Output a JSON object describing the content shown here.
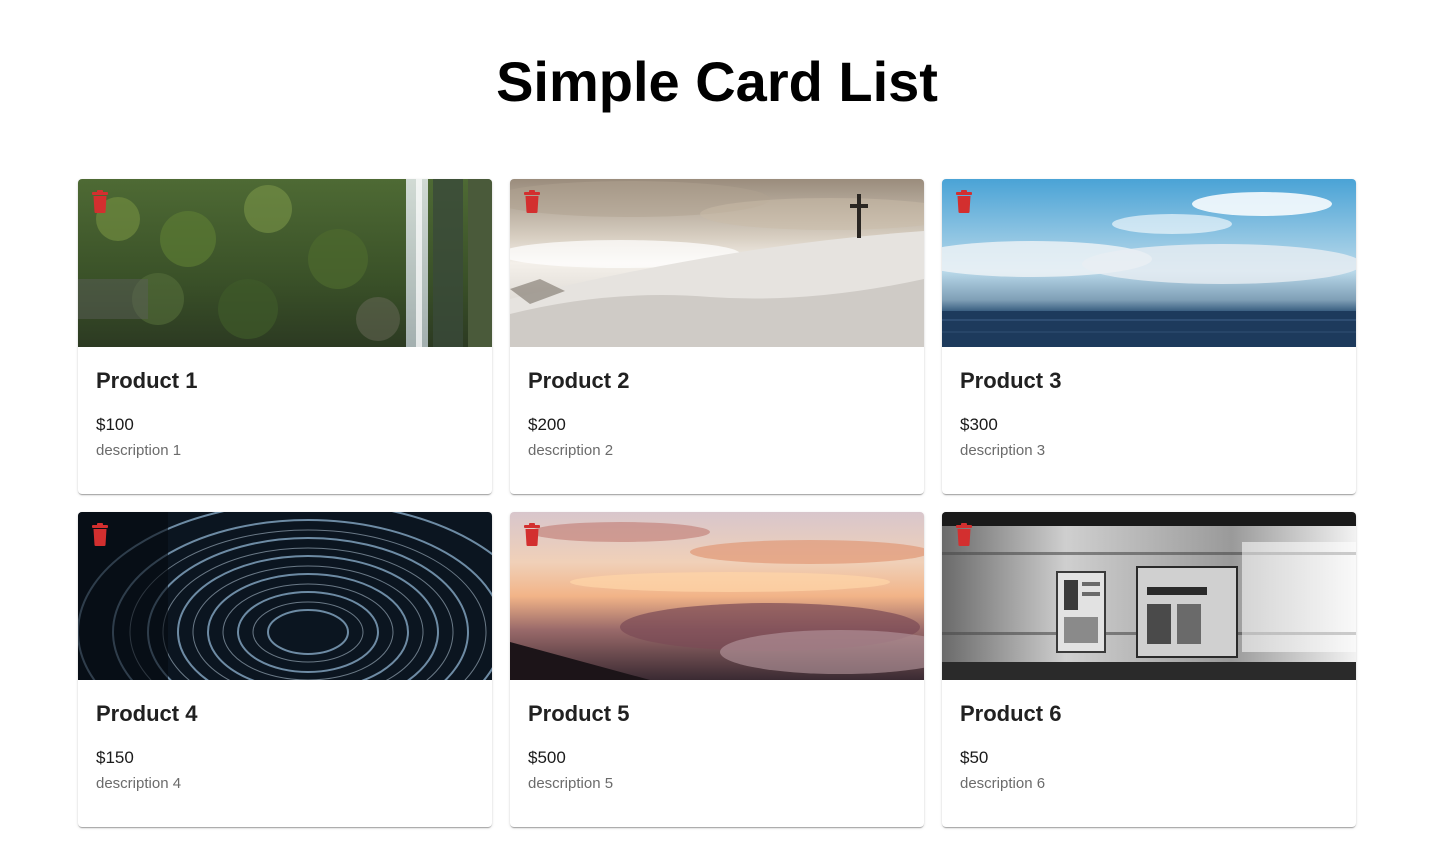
{
  "page": {
    "title": "Simple Card List"
  },
  "accent": {
    "delete_icon_color": "#d32f2f"
  },
  "cards": [
    {
      "name": "Product 1",
      "price": "$100",
      "description": "description 1",
      "image": "waterfall-cliff-photo"
    },
    {
      "name": "Product 2",
      "price": "$200",
      "description": "description 2",
      "image": "snowy-hill-cross-photo"
    },
    {
      "name": "Product 3",
      "price": "$300",
      "description": "description 3",
      "image": "ocean-sky-photo"
    },
    {
      "name": "Product 4",
      "price": "$150",
      "description": "description 4",
      "image": "star-trails-photo"
    },
    {
      "name": "Product 5",
      "price": "$500",
      "description": "description 5",
      "image": "sunset-clouds-photo"
    },
    {
      "name": "Product 6",
      "price": "$50",
      "description": "description 6",
      "image": "motion-blur-train-photo"
    }
  ]
}
